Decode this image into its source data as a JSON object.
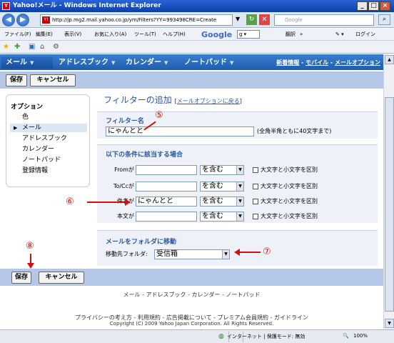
{
  "window": {
    "title": "Yahoo!メール - Windows Internet Explorer",
    "min": "_",
    "max": "□",
    "close": "×"
  },
  "address": {
    "url": "http://jp.mg2.mail.yahoo.co.jp/ym/Filters?YY=993498CRE=Create",
    "search_placeholder": "Google"
  },
  "menu": {
    "items": [
      "ファイル(F)",
      "編集(E)",
      "表示(V)",
      "お気に入り(A)",
      "ツール(T)",
      "ヘルプ(H)"
    ],
    "google": "Google",
    "translate": "翻訳",
    "more": "»",
    "login": "ログイン"
  },
  "tabs": [
    {
      "label": "メール"
    },
    {
      "label": "アドレスブック"
    },
    {
      "label": "カレンダー"
    },
    {
      "label": "ノートパッド"
    }
  ],
  "toplinks": {
    "news": "新着情報",
    "sep": " - ",
    "mobile": "モバイル",
    "sep2": " - ",
    "options": "メールオプション"
  },
  "toolbar": {
    "save": "保存",
    "cancel": "キャンセル"
  },
  "sidebar": {
    "heading": "オプション",
    "items": [
      "色",
      "メール",
      "アドレスブック",
      "カレンダー",
      "ノートパッド",
      "登録情報"
    ]
  },
  "form": {
    "title": "フィルターの追加",
    "back_open": "[",
    "back_link": "メールオプションに戻る",
    "back_close": "]",
    "name_label": "フィルター名",
    "name_value": "にゃんとと",
    "name_hint": "(全角半角ともに40文字まで)",
    "cond_title": "以下の条件に該当する場合",
    "rows": [
      {
        "label": "Fromが",
        "value": "",
        "op": "を含む",
        "case": "大文字と小文字を区別"
      },
      {
        "label": "To/Ccが",
        "value": "",
        "op": "を含む",
        "case": "大文字と小文字を区別"
      },
      {
        "label": "件名が",
        "value": "にゃんとと",
        "op": "を含む",
        "case": "大文字と小文字を区別"
      },
      {
        "label": "本文が",
        "value": "",
        "op": "を含む",
        "case": "大文字と小文字を区別"
      }
    ],
    "move_title": "メールをフォルダに移動",
    "folder_label": "移動先フォルダ:",
    "folder_value": "受信箱"
  },
  "annotations": {
    "n5": "⑤",
    "n6": "⑥",
    "n7": "⑦",
    "n8": "⑧"
  },
  "footer": {
    "links": "メール - アドレスブック - カレンダー - ノートパッド",
    "legal": "プライバシーの考え方 - 利用規約 - 広告掲載について - プレミアム会員規約 - ガイドライン",
    "copyright": "Copyright (C) 2009 Yahoo Japan Corporation. All Rights Reserved."
  },
  "status": {
    "zone": "インターネット | 保護モード: 無効",
    "zoom": "100%"
  }
}
